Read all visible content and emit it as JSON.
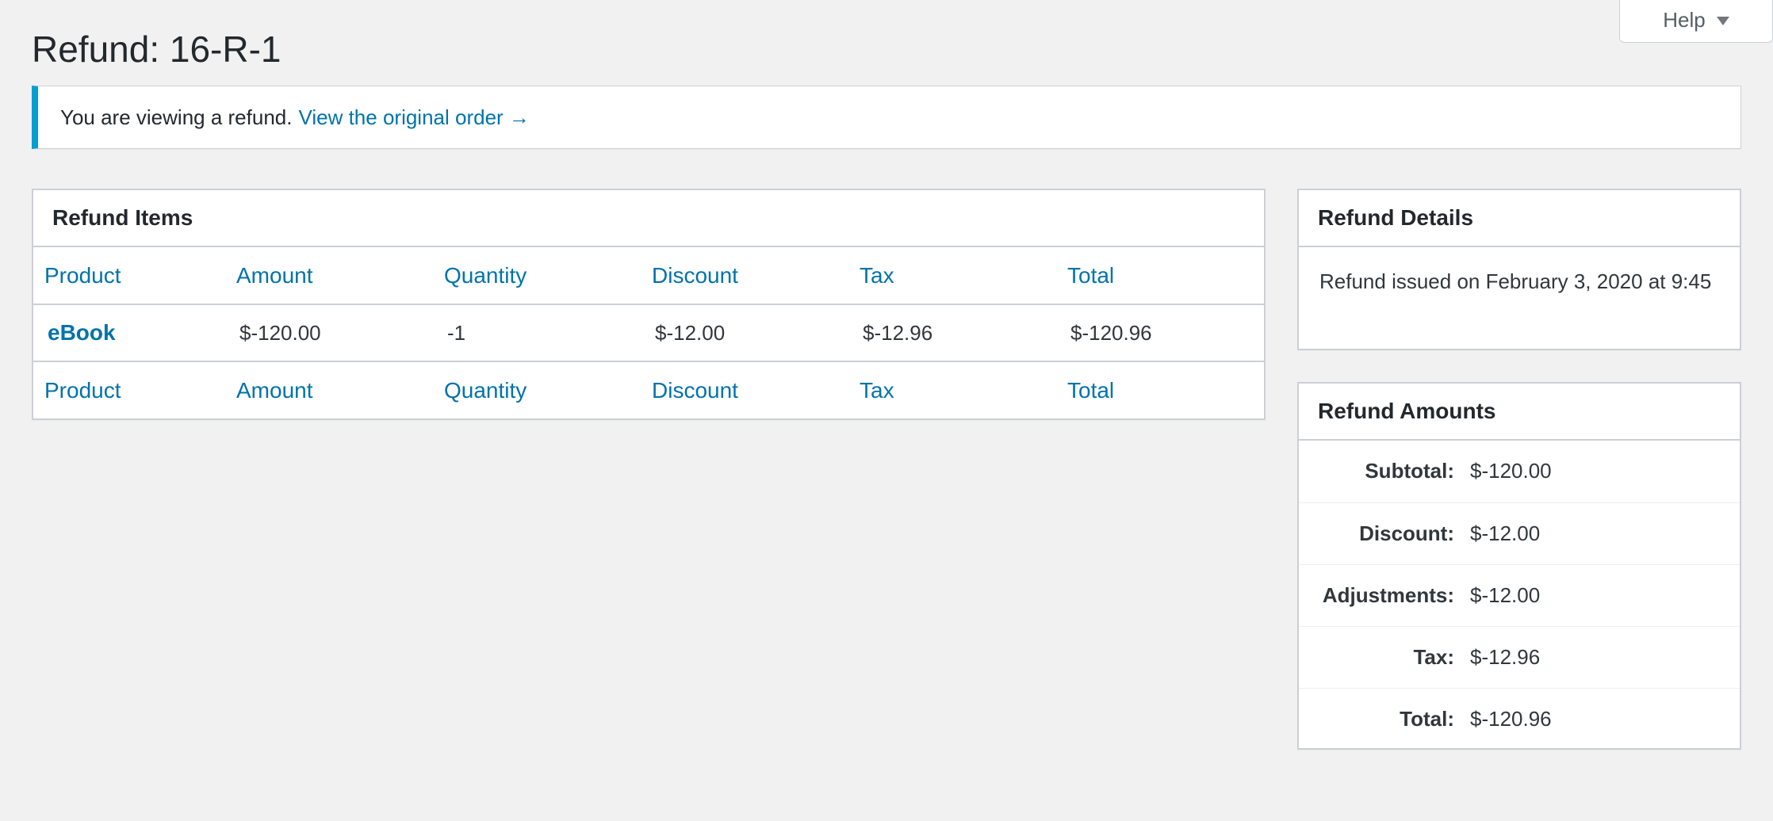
{
  "help_tab": {
    "label": "Help"
  },
  "page": {
    "title": "Refund: 16-R-1"
  },
  "notice": {
    "text": "You are viewing a refund.",
    "link": "View the original order →"
  },
  "refund_items": {
    "title": "Refund Items",
    "columns": [
      "Product",
      "Amount",
      "Quantity",
      "Discount",
      "Tax",
      "Total"
    ],
    "rows": [
      {
        "product": "eBook",
        "amount": "$-120.00",
        "quantity": "-1",
        "discount": "$-12.00",
        "tax": "$-12.96",
        "total": "$-120.96"
      }
    ]
  },
  "refund_details": {
    "title": "Refund Details",
    "text": "Refund issued on February 3, 2020 at 9:45"
  },
  "refund_amounts": {
    "title": "Refund Amounts",
    "rows": [
      {
        "label": "Subtotal:",
        "value": "$-120.00"
      },
      {
        "label": "Discount:",
        "value": "$-12.00"
      },
      {
        "label": "Adjustments:",
        "value": "$-12.00"
      },
      {
        "label": "Tax:",
        "value": "$-12.96"
      },
      {
        "label": "Total:",
        "value": "$-120.96"
      }
    ]
  },
  "colors": {
    "link": "#0073aa",
    "notice_accent": "#00a0d2",
    "background": "#f1f1f1"
  }
}
